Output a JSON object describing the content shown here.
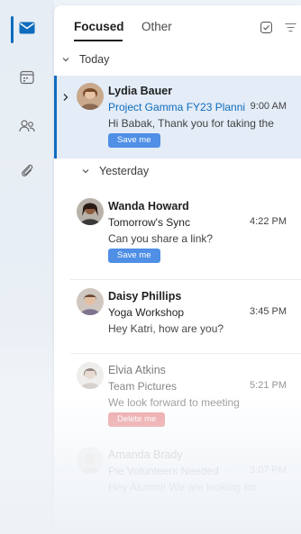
{
  "tabs": {
    "focused": "Focused",
    "other": "Other"
  },
  "groups": {
    "today": "Today",
    "yesterday": "Yesterday"
  },
  "messages": [
    {
      "sender": "Lydia Bauer",
      "subject": "Project Gamma FY23 Planni",
      "time": "9:00 AM",
      "preview": "Hi Babak, Thank you for taking the",
      "chip": "Save me",
      "selected": true
    },
    {
      "sender": "Wanda Howard",
      "subject": "Tomorrow's Sync",
      "time": "4:22 PM",
      "preview": "Can you share a link?",
      "chip": "Save me"
    },
    {
      "sender": "Daisy Phillips",
      "subject": "Yoga Workshop",
      "time": "3:45 PM",
      "preview": "Hey Katri, how are you?"
    },
    {
      "sender": "Elvia Atkins",
      "subject": "Team Pictures",
      "time": "5:21 PM",
      "preview": "We look forward to meeting",
      "chip": "Delete me"
    },
    {
      "sender": "Amanda Brady",
      "subject": "Pie Volunteers Needed",
      "time": "3:07 PM",
      "preview": "Hey Alumni! We are looking for"
    }
  ],
  "colors": {
    "accent": "#0f6cbd",
    "selected_bg": "#e3ecf7",
    "chip_blue": "#4f8fe6",
    "chip_red": "#e25b5b"
  },
  "icons": {
    "rail": [
      "mail-icon",
      "calendar-icon",
      "people-icon",
      "attachment-icon"
    ],
    "toolbar": [
      "select-mode-icon",
      "filter-icon"
    ]
  }
}
